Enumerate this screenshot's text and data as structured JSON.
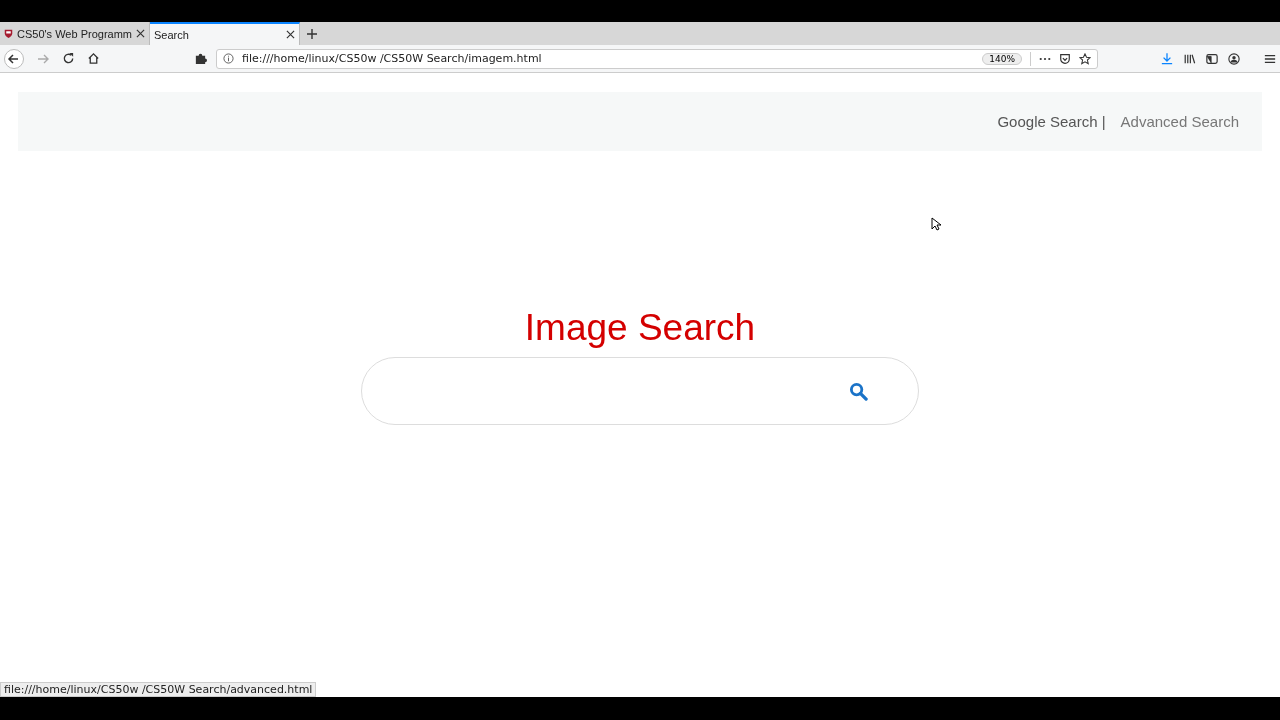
{
  "tabs": [
    {
      "label": "CS50's Web Programm",
      "selected": false
    },
    {
      "label": "Search",
      "selected": true
    }
  ],
  "address_bar": {
    "url": "file:///home/linux/CS50w /CS50W Search/imagem.html",
    "zoom": "140%"
  },
  "nav_links": [
    "Google Search |",
    "Advanced Search"
  ],
  "heading": "Image Search",
  "status_bar": "file:///home/linux/CS50w /CS50W Search/advanced.html"
}
